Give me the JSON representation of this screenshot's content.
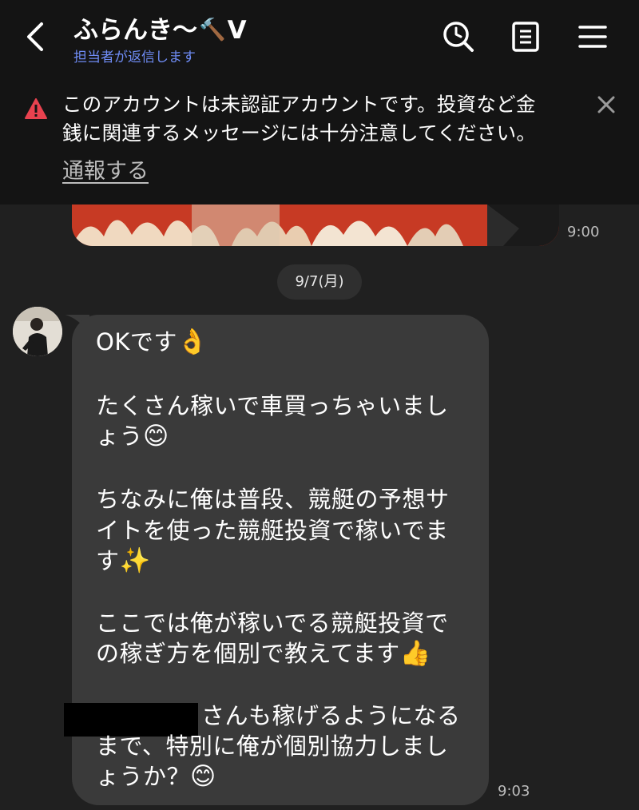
{
  "header": {
    "title": "ふらんき〜",
    "title_icon": "🔨",
    "title_suffix": "V",
    "subtitle": "担当者が返信します",
    "icons": [
      "chevron-left-icon",
      "search-clock-icon",
      "notes-icon",
      "hamburger-menu-icon"
    ]
  },
  "warning": {
    "text_line1": "このアカウントは未認証アカウントです。投資など金",
    "text_line2": "銭に関連するメッセージには十分注意してください。",
    "report_label": "通報する",
    "icons": [
      "warning-triangle-icon",
      "close-icon"
    ]
  },
  "messages": {
    "prev_time": "9:00",
    "date_chip": "9/7(月)",
    "time": "9:03",
    "lines": [
      {
        "text": "OKです",
        "emoji": "👌"
      },
      {
        "text": "たくさん稼いで車買っちゃいまし",
        "emoji": ""
      },
      {
        "text": "ょう",
        "emoji": "😊"
      },
      {
        "text": "ちなみに俺は普段、競艇の予想サ",
        "emoji": ""
      },
      {
        "text": "イトを使った競艇投資で稼いでま",
        "emoji": ""
      },
      {
        "text": "す",
        "emoji": "✨"
      },
      {
        "text": "ここでは俺が稼いでる競艇投資で",
        "emoji": ""
      },
      {
        "text": "の稼ぎ方を個別で教えてます",
        "emoji": "👍"
      },
      {
        "text": "さんも稼げるようになる",
        "emoji": ""
      },
      {
        "text": "まで、特別に俺が個別協力しまし",
        "emoji": ""
      },
      {
        "text": "ょうか？",
        "emoji": "😊"
      }
    ]
  },
  "colors": {
    "background": "#202020",
    "header_bg": "#141414",
    "bubble_bg": "#3a3a3a",
    "subtitle_blue": "#6f8cf5",
    "warning_red": "#e8424f"
  }
}
